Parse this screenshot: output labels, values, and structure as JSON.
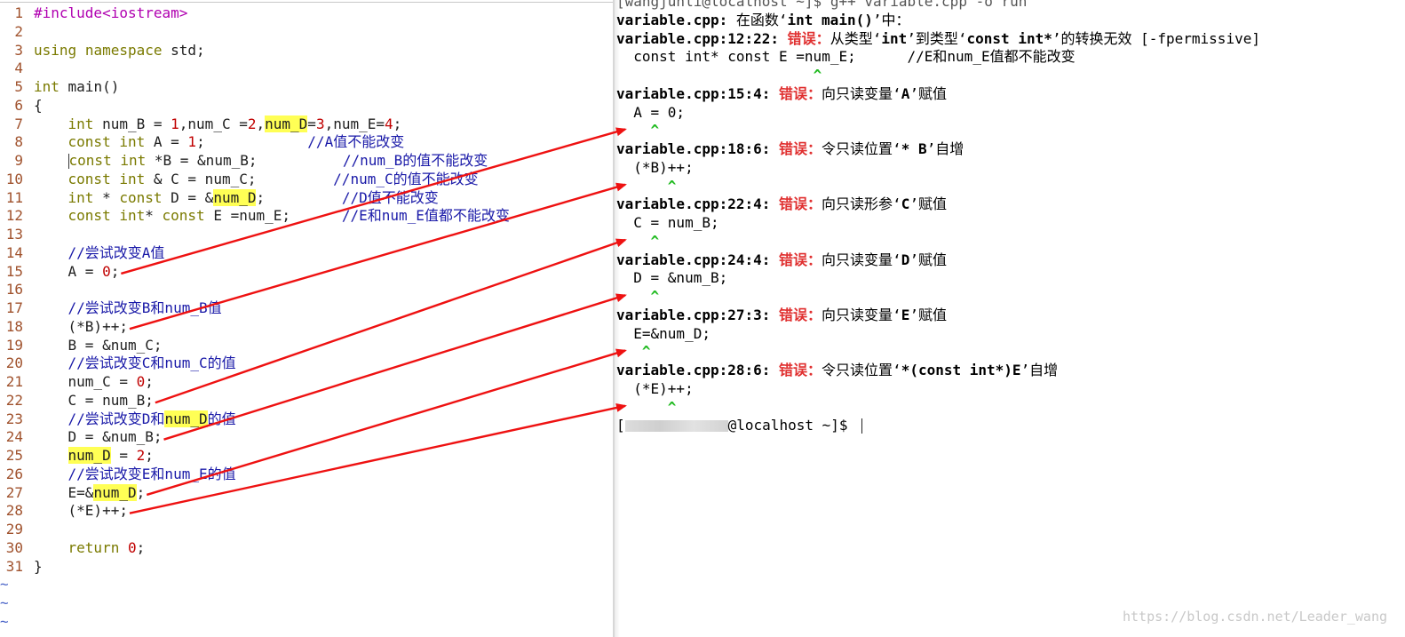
{
  "editor": {
    "lines": [
      {
        "n": "1",
        "tokens": [
          {
            "t": "#include<iostream>",
            "c": "pp"
          }
        ]
      },
      {
        "n": "2",
        "tokens": []
      },
      {
        "n": "3",
        "tokens": [
          {
            "t": "using",
            "c": "kw"
          },
          {
            "t": " "
          },
          {
            "t": "namespace",
            "c": "kw"
          },
          {
            "t": " std;"
          }
        ]
      },
      {
        "n": "4",
        "tokens": []
      },
      {
        "n": "5",
        "tokens": [
          {
            "t": "int",
            "c": "kw"
          },
          {
            "t": " main()"
          }
        ]
      },
      {
        "n": "6",
        "tokens": [
          {
            "t": "{"
          }
        ]
      },
      {
        "n": "7",
        "tokens": [
          {
            "t": "    "
          },
          {
            "t": "int",
            "c": "kw"
          },
          {
            "t": " num_B = "
          },
          {
            "t": "1",
            "c": "num"
          },
          {
            "t": ",num_C ="
          },
          {
            "t": "2",
            "c": "num"
          },
          {
            "t": ","
          },
          {
            "t": "num_D",
            "c": "hl"
          },
          {
            "t": "="
          },
          {
            "t": "3",
            "c": "num"
          },
          {
            "t": ",num_E="
          },
          {
            "t": "4",
            "c": "num"
          },
          {
            "t": ";"
          }
        ]
      },
      {
        "n": "8",
        "tokens": [
          {
            "t": "    "
          },
          {
            "t": "const",
            "c": "kw"
          },
          {
            "t": " "
          },
          {
            "t": "int",
            "c": "kw"
          },
          {
            "t": " A = "
          },
          {
            "t": "1",
            "c": "num"
          },
          {
            "t": ";            "
          },
          {
            "t": "//A值不能改变",
            "c": "cm"
          }
        ]
      },
      {
        "n": "9",
        "tokens": [
          {
            "t": "    "
          },
          {
            "t": "",
            "c": "cursor"
          },
          {
            "t": "const",
            "c": "kw"
          },
          {
            "t": " "
          },
          {
            "t": "int",
            "c": "kw"
          },
          {
            "t": " *B = &num_B;          "
          },
          {
            "t": "//num_B的值不能改变",
            "c": "cm"
          }
        ]
      },
      {
        "n": "10",
        "tokens": [
          {
            "t": "    "
          },
          {
            "t": "const",
            "c": "kw"
          },
          {
            "t": " "
          },
          {
            "t": "int",
            "c": "kw"
          },
          {
            "t": " & C = num_C;         "
          },
          {
            "t": "//num_C的值不能改变",
            "c": "cm"
          }
        ]
      },
      {
        "n": "11",
        "tokens": [
          {
            "t": "    "
          },
          {
            "t": "int",
            "c": "kw"
          },
          {
            "t": " * "
          },
          {
            "t": "const",
            "c": "kw"
          },
          {
            "t": " D = &"
          },
          {
            "t": "num_D",
            "c": "hl"
          },
          {
            "t": ";         "
          },
          {
            "t": "//D值不能改变",
            "c": "cm"
          }
        ]
      },
      {
        "n": "12",
        "tokens": [
          {
            "t": "    "
          },
          {
            "t": "const",
            "c": "kw"
          },
          {
            "t": " "
          },
          {
            "t": "int",
            "c": "kw"
          },
          {
            "t": "* "
          },
          {
            "t": "const",
            "c": "kw"
          },
          {
            "t": " E =num_E;      "
          },
          {
            "t": "//E和num_E值都不能改变",
            "c": "cm"
          }
        ]
      },
      {
        "n": "13",
        "tokens": []
      },
      {
        "n": "14",
        "tokens": [
          {
            "t": "    "
          },
          {
            "t": "//尝试改变A值",
            "c": "cm"
          }
        ]
      },
      {
        "n": "15",
        "tokens": [
          {
            "t": "    A = "
          },
          {
            "t": "0",
            "c": "num"
          },
          {
            "t": ";"
          }
        ]
      },
      {
        "n": "16",
        "tokens": []
      },
      {
        "n": "17",
        "tokens": [
          {
            "t": "    "
          },
          {
            "t": "//尝试改变B和num_B值",
            "c": "cm"
          }
        ]
      },
      {
        "n": "18",
        "tokens": [
          {
            "t": "    (*B)++;"
          }
        ]
      },
      {
        "n": "19",
        "tokens": [
          {
            "t": "    B = &num_C;"
          }
        ]
      },
      {
        "n": "20",
        "tokens": [
          {
            "t": "    "
          },
          {
            "t": "//尝试改变C和num_C的值",
            "c": "cm"
          }
        ]
      },
      {
        "n": "21",
        "tokens": [
          {
            "t": "    num_C = "
          },
          {
            "t": "0",
            "c": "num"
          },
          {
            "t": ";"
          }
        ]
      },
      {
        "n": "22",
        "tokens": [
          {
            "t": "    C = num_B;"
          }
        ]
      },
      {
        "n": "23",
        "tokens": [
          {
            "t": "    "
          },
          {
            "t": "//尝试改变D和",
            "c": "cm"
          },
          {
            "t": "num_D",
            "c": "hl"
          },
          {
            "t": "的值",
            "c": "cm"
          }
        ]
      },
      {
        "n": "24",
        "tokens": [
          {
            "t": "    D = &num_B;"
          }
        ]
      },
      {
        "n": "25",
        "tokens": [
          {
            "t": "    "
          },
          {
            "t": "num_D",
            "c": "hl"
          },
          {
            "t": " = "
          },
          {
            "t": "2",
            "c": "num"
          },
          {
            "t": ";"
          }
        ]
      },
      {
        "n": "26",
        "tokens": [
          {
            "t": "    "
          },
          {
            "t": "//尝试改变E和num_E的值",
            "c": "cm"
          }
        ]
      },
      {
        "n": "27",
        "tokens": [
          {
            "t": "    E=&"
          },
          {
            "t": "num_D",
            "c": "hl"
          },
          {
            "t": ";"
          }
        ]
      },
      {
        "n": "28",
        "tokens": [
          {
            "t": "    (*E)++;"
          }
        ]
      },
      {
        "n": "29",
        "tokens": []
      },
      {
        "n": "30",
        "tokens": [
          {
            "t": "    "
          },
          {
            "t": "return",
            "c": "kw"
          },
          {
            "t": " "
          },
          {
            "t": "0",
            "c": "num"
          },
          {
            "t": ";"
          }
        ]
      },
      {
        "n": "31",
        "tokens": [
          {
            "t": "}"
          }
        ]
      }
    ],
    "empty_marker": "~",
    "empty_rows": 3
  },
  "terminal": {
    "lines": [
      [
        {
          "t": "[wangjunli@localhost ~]$ g++ variable.cpp -o run",
          "c": "cut"
        }
      ],
      [
        {
          "t": "variable.cpp:",
          "c": "bold"
        },
        {
          "t": " 在函数‘"
        },
        {
          "t": "int main()",
          "c": "bold"
        },
        {
          "t": "’中："
        }
      ],
      [
        {
          "t": "variable.cpp:12:22:",
          "c": "bold"
        },
        {
          "t": " "
        },
        {
          "t": "错误：",
          "c": "err"
        },
        {
          "t": "从类型‘"
        },
        {
          "t": "int",
          "c": "bold"
        },
        {
          "t": "’到类型‘"
        },
        {
          "t": "const int*",
          "c": "bold"
        },
        {
          "t": "’的转换无效 [-fpermissive]"
        }
      ],
      [
        {
          "t": "  const int* const E =num_E;      //E和num_E值都不能改变"
        }
      ],
      [
        {
          "t": "                       "
        },
        {
          "t": "^",
          "c": "caret"
        }
      ],
      [
        {
          "t": "variable.cpp:15:4:",
          "c": "bold"
        },
        {
          "t": " "
        },
        {
          "t": "错误：",
          "c": "err"
        },
        {
          "t": "向只读变量‘"
        },
        {
          "t": "A",
          "c": "bold"
        },
        {
          "t": "’赋值"
        }
      ],
      [
        {
          "t": "  A = 0;"
        }
      ],
      [
        {
          "t": "    "
        },
        {
          "t": "^",
          "c": "caret"
        }
      ],
      [
        {
          "t": "variable.cpp:18:6:",
          "c": "bold"
        },
        {
          "t": " "
        },
        {
          "t": "错误：",
          "c": "err"
        },
        {
          "t": "令只读位置‘"
        },
        {
          "t": "* B",
          "c": "bold"
        },
        {
          "t": "’自增"
        }
      ],
      [
        {
          "t": "  (*B)++;"
        }
      ],
      [
        {
          "t": "      "
        },
        {
          "t": "^",
          "c": "caret"
        }
      ],
      [
        {
          "t": "variable.cpp:22:4:",
          "c": "bold"
        },
        {
          "t": " "
        },
        {
          "t": "错误：",
          "c": "err"
        },
        {
          "t": "向只读形参‘"
        },
        {
          "t": "C",
          "c": "bold"
        },
        {
          "t": "’赋值"
        }
      ],
      [
        {
          "t": "  C = num_B;"
        }
      ],
      [
        {
          "t": "    "
        },
        {
          "t": "^",
          "c": "caret"
        }
      ],
      [
        {
          "t": "variable.cpp:24:4:",
          "c": "bold"
        },
        {
          "t": " "
        },
        {
          "t": "错误：",
          "c": "err"
        },
        {
          "t": "向只读变量‘"
        },
        {
          "t": "D",
          "c": "bold"
        },
        {
          "t": "’赋值"
        }
      ],
      [
        {
          "t": "  D = &num_B;"
        }
      ],
      [
        {
          "t": "    "
        },
        {
          "t": "^",
          "c": "caret"
        }
      ],
      [
        {
          "t": "variable.cpp:27:3:",
          "c": "bold"
        },
        {
          "t": " "
        },
        {
          "t": "错误：",
          "c": "err"
        },
        {
          "t": "向只读变量‘"
        },
        {
          "t": "E",
          "c": "bold"
        },
        {
          "t": "’赋值"
        }
      ],
      [
        {
          "t": "  E=&num_D;"
        }
      ],
      [
        {
          "t": "   "
        },
        {
          "t": "^",
          "c": "caret"
        }
      ],
      [
        {
          "t": "variable.cpp:28:6:",
          "c": "bold"
        },
        {
          "t": " "
        },
        {
          "t": "错误：",
          "c": "err"
        },
        {
          "t": "令只读位置‘"
        },
        {
          "t": "*(const int*)E",
          "c": "bold"
        },
        {
          "t": "’自增"
        }
      ],
      [
        {
          "t": "  (*E)++;"
        }
      ],
      [
        {
          "t": "      "
        },
        {
          "t": "^",
          "c": "caret"
        }
      ],
      [
        {
          "t": "["
        },
        {
          "t": "",
          "c": "blur"
        },
        {
          "t": "@localhost ~]$ "
        },
        {
          "t": "",
          "c": "cursor"
        }
      ]
    ]
  },
  "annotations": {
    "arrow_color": "#ee1111",
    "arrows": [
      {
        "from_editor_line": 15,
        "to_terminal_line": 7
      },
      {
        "from_editor_line": 18,
        "to_terminal_line": 10
      },
      {
        "from_editor_line": 22,
        "to_terminal_line": 13
      },
      {
        "from_editor_line": 24,
        "to_terminal_line": 16
      },
      {
        "from_editor_line": 27,
        "to_terminal_line": 19
      },
      {
        "from_editor_line": 28,
        "to_terminal_line": 22
      }
    ]
  },
  "watermark": "https://blog.csdn.net/Leader_wang"
}
